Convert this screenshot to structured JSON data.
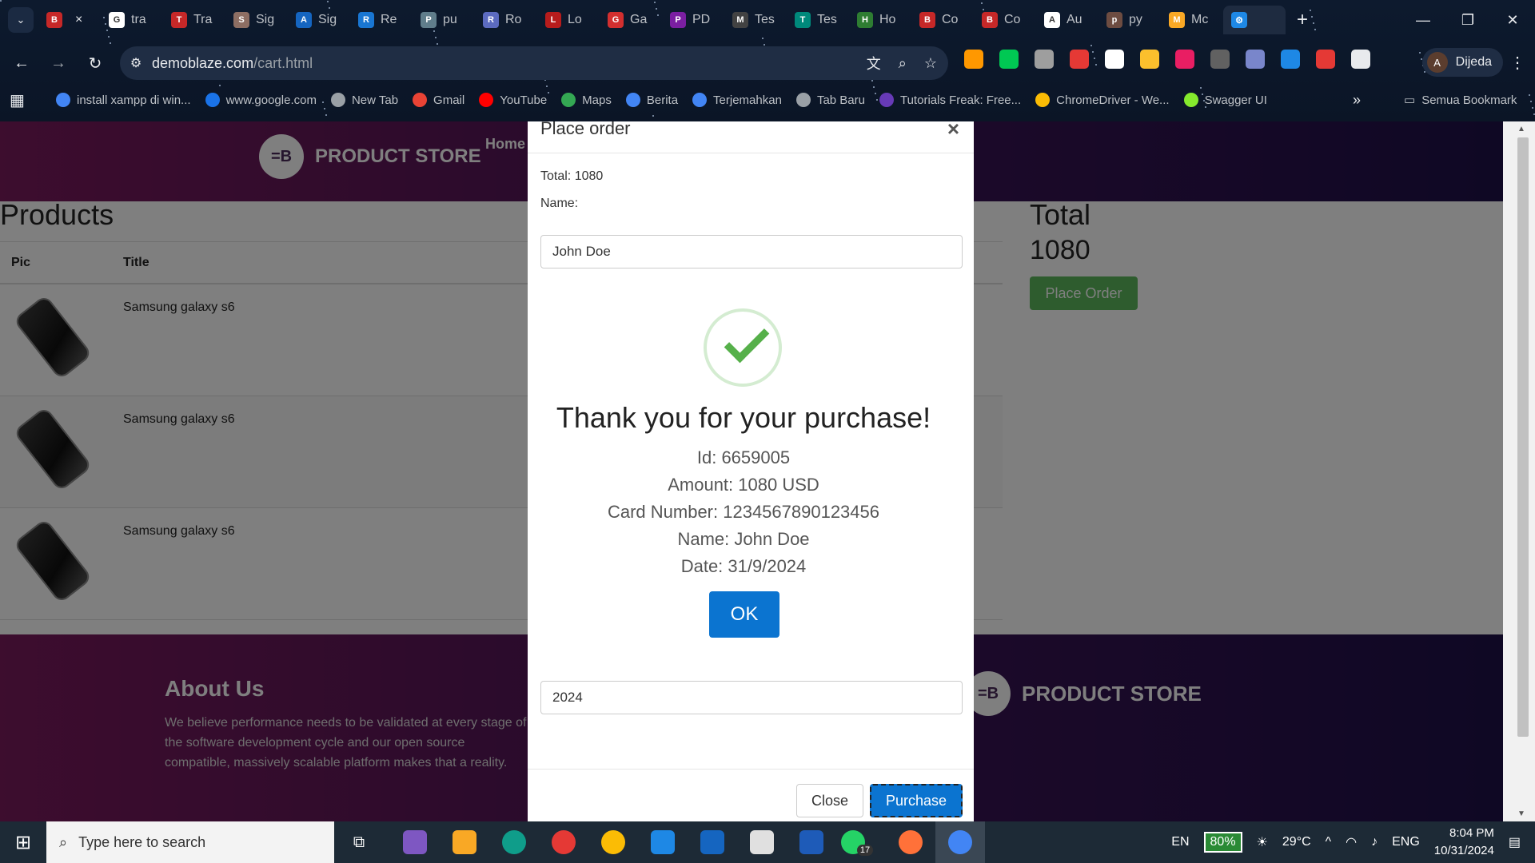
{
  "browser": {
    "tabs": [
      {
        "label": "",
        "color": "#c62828",
        "glyph": "B",
        "active": false
      },
      {
        "label": "tra",
        "color": "#ffffff",
        "glyph": "G"
      },
      {
        "label": "Tra",
        "color": "#c62828",
        "glyph": "T"
      },
      {
        "label": "Sig",
        "color": "#8d6e63",
        "glyph": "S"
      },
      {
        "label": "Sig",
        "color": "#1565c0",
        "glyph": "A"
      },
      {
        "label": "Re",
        "color": "#1976d2",
        "glyph": "R"
      },
      {
        "label": "pu",
        "color": "#607d8b",
        "glyph": "P"
      },
      {
        "label": "Ro",
        "color": "#5c6bc0",
        "glyph": "R"
      },
      {
        "label": "Lo",
        "color": "#b71c1c",
        "glyph": "L"
      },
      {
        "label": "Ga",
        "color": "#d32f2f",
        "glyph": "G"
      },
      {
        "label": "PD",
        "color": "#7b1fa2",
        "glyph": "P"
      },
      {
        "label": "Tes",
        "color": "#424242",
        "glyph": "M"
      },
      {
        "label": "Tes",
        "color": "#00897b",
        "glyph": "T"
      },
      {
        "label": "Ho",
        "color": "#2e7d32",
        "glyph": "H"
      },
      {
        "label": "Co",
        "color": "#c62828",
        "glyph": "B"
      },
      {
        "label": "Co",
        "color": "#c62828",
        "glyph": "B"
      },
      {
        "label": "Au",
        "color": "#ffffff",
        "glyph": "A"
      },
      {
        "label": "py",
        "color": "#6d4c41",
        "glyph": "p"
      },
      {
        "label": "Mc",
        "color": "#f9a825",
        "glyph": "M"
      },
      {
        "label": "",
        "color": "#1e88e5",
        "glyph": "⚙",
        "active": true
      }
    ],
    "url_domain": "demoblaze.com",
    "url_path": "/cart.html",
    "profile_name": "Dijeda",
    "profile_initial": "A",
    "bookmarks": [
      {
        "label": "install xampp di win...",
        "color": "#4285f4"
      },
      {
        "label": "www.google.com",
        "color": "#1a73e8"
      },
      {
        "label": "New Tab",
        "color": "#9aa0a6"
      },
      {
        "label": "Gmail",
        "color": "#ea4335"
      },
      {
        "label": "YouTube",
        "color": "#ff0000"
      },
      {
        "label": "Maps",
        "color": "#34a853"
      },
      {
        "label": "Berita",
        "color": "#4285f4"
      },
      {
        "label": "Terjemahkan",
        "color": "#4285f4"
      },
      {
        "label": "Tab Baru",
        "color": "#9aa0a6"
      },
      {
        "label": "Tutorials Freak: Free...",
        "color": "#673ab7"
      },
      {
        "label": "ChromeDriver - We...",
        "color": "#fbbc05"
      },
      {
        "label": "Swagger UI",
        "color": "#85ea2d"
      }
    ],
    "bookmarks_folder": "Semua Bookmark"
  },
  "page": {
    "brand": "PRODUCT STORE",
    "nav_home": "Home",
    "products_heading": "Products",
    "table_headers": {
      "pic": "Pic",
      "title": "Title"
    },
    "cart_items": [
      {
        "title": "Samsung galaxy s6"
      },
      {
        "title": "Samsung galaxy s6"
      },
      {
        "title": "Samsung galaxy s6"
      }
    ],
    "total_heading": "Total",
    "total_value": "1080",
    "place_order_label": "Place Order",
    "about_heading": "About Us",
    "about_text": "We believe performance needs to be validated at every stage of the software development cycle and our open source compatible, massively scalable platform makes that a reality.",
    "footer_brand": "PRODUCT STORE"
  },
  "modal": {
    "title": "Place order",
    "close_x": "×",
    "total_line": "Total: 1080",
    "name_label": "Name:",
    "name_value": "John Doe",
    "year_value": "2024",
    "close_label": "Close",
    "purchase_label": "Purchase"
  },
  "alert": {
    "title": "Thank you for your purchase!",
    "id_line": "Id: 6659005",
    "amount_line": "Amount: 1080 USD",
    "card_line": "Card Number: 1234567890123456",
    "name_line": "Name: John Doe",
    "date_line": "Date: 31/9/2024",
    "ok_label": "OK"
  },
  "taskbar": {
    "search_placeholder": "Type here to search",
    "apps": [
      {
        "name": "copilot",
        "color": "#7e57c2"
      },
      {
        "name": "file-explorer",
        "color": "#f9a825"
      },
      {
        "name": "edge",
        "color": "#0f9d8a"
      },
      {
        "name": "opera",
        "color": "#e53935"
      },
      {
        "name": "chrome",
        "color": "#fbbc05"
      },
      {
        "name": "vscode",
        "color": "#1e88e5"
      },
      {
        "name": "l-app",
        "color": "#1565c0"
      },
      {
        "name": "app-store",
        "color": "#e0e0e0"
      },
      {
        "name": "word",
        "color": "#1e5bb8"
      },
      {
        "name": "whatsapp",
        "color": "#25d366"
      },
      {
        "name": "firefox",
        "color": "#ff7139"
      },
      {
        "name": "chrome-profile",
        "color": "#4285f4"
      }
    ],
    "whatsapp_badge": "17",
    "lang_short": "EN",
    "battery": "80%",
    "temperature": "29°C",
    "lang": "ENG",
    "time": "8:04 PM",
    "date": "10/31/2024"
  }
}
